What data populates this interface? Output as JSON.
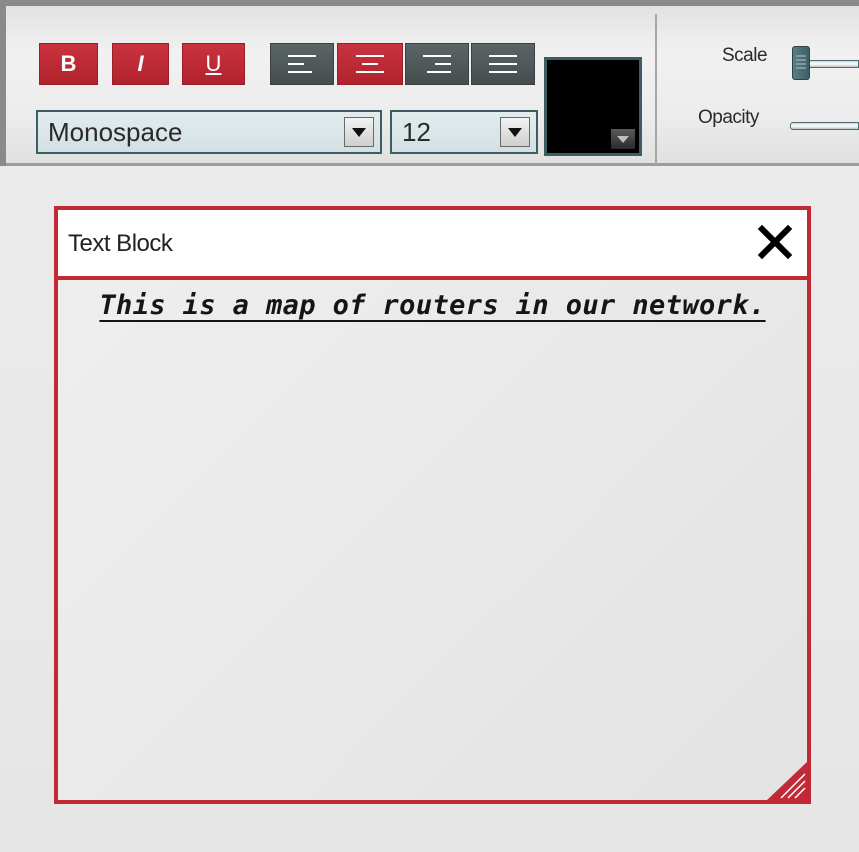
{
  "toolbar": {
    "bold_label": "B",
    "italic_label": "I",
    "underline_label": "U",
    "align_left_icon": "align-left-icon",
    "align_center_icon": "align-center-icon",
    "align_right_icon": "align-right-icon",
    "justify_icon": "justify-icon",
    "font_family": "Monospace",
    "font_size": "12",
    "text_color": "#000000",
    "scale_label": "Scale",
    "opacity_label": "Opacity"
  },
  "colors": {
    "accent_red": "#c12a35",
    "button_dark": "#4d5658",
    "select_border": "#3d5d64"
  },
  "panel": {
    "title": "Text Block",
    "close_icon": "close-icon",
    "content": "This is a map of routers in our network.",
    "resize_icon": "resize-grip-icon"
  }
}
